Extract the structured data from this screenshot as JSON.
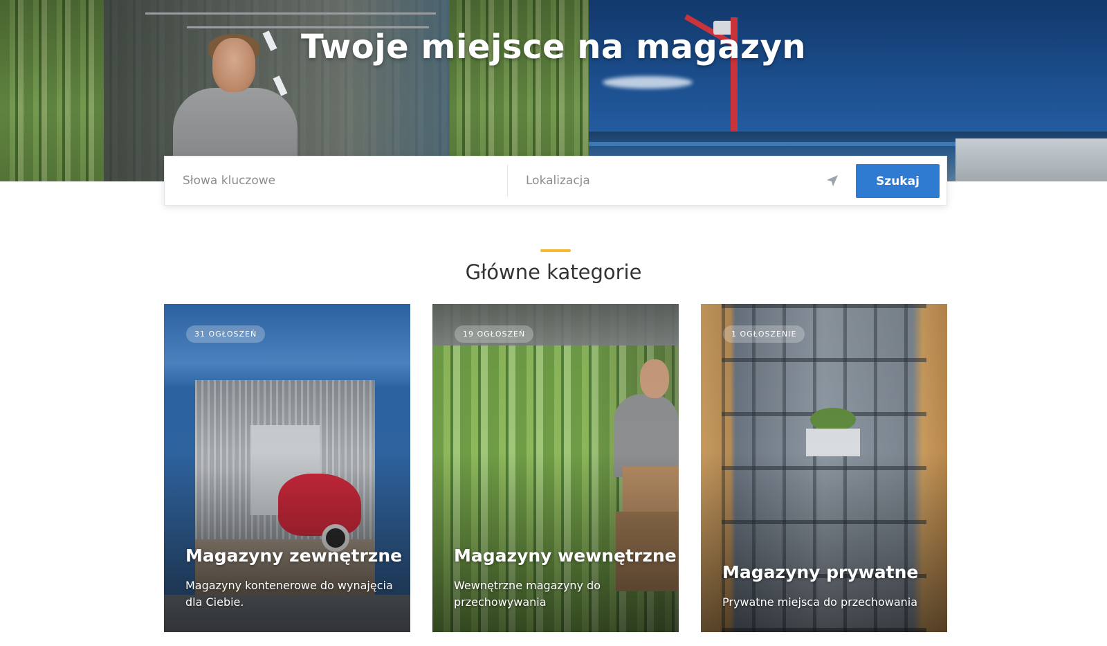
{
  "hero": {
    "title": "Twoje miejsce na magazyn"
  },
  "search": {
    "keywords_placeholder": "Słowa kluczowe",
    "location_placeholder": "Lokalizacja",
    "locate_icon": "location-arrow-icon",
    "button_label": "Szukaj"
  },
  "section": {
    "title": "Główne kategorie"
  },
  "categories": [
    {
      "badge": "31 OGŁOSZEŃ",
      "title": "Magazyny zewnętrzne",
      "description": "Magazyny kontenerowe do wynajęcia dla Ciebie."
    },
    {
      "badge": "19 OGŁOSZEŃ",
      "title": "Magazyny wewnętrzne",
      "description": "Wewnętrzne magazyny do przechowywania"
    },
    {
      "badge": "1 OGŁOSZENIE",
      "title": "Magazyny prywatne",
      "description": "Prywatne miejsca do przechowania"
    }
  ],
  "colors": {
    "primary_button": "#2f7bd2",
    "accent": "#f5b82e"
  }
}
